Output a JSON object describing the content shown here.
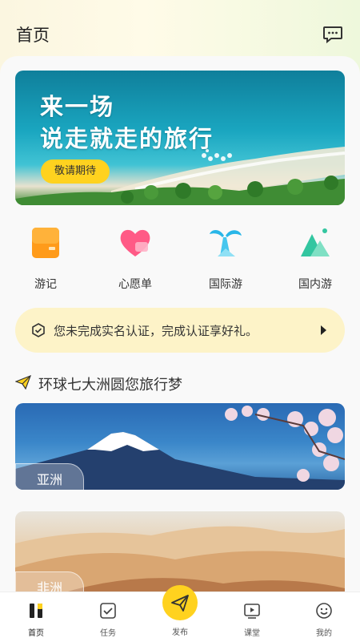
{
  "header": {
    "title": "首页",
    "message_icon": "message-icon"
  },
  "banner": {
    "line1": "来一场",
    "line2": "说走就走的旅行",
    "button": "敬请期待"
  },
  "categories": [
    {
      "label": "游记",
      "icon": "travel-notes-icon",
      "color": "#ff9b1a"
    },
    {
      "label": "心愿单",
      "icon": "heart-icon",
      "color": "#ff5a86"
    },
    {
      "label": "国际游",
      "icon": "palm-tree-icon",
      "color": "#29b6e8"
    },
    {
      "label": "国内游",
      "icon": "mountain-icon",
      "color": "#33c6a0"
    }
  ],
  "notice": {
    "text": "您未完成实名认证，完成认证享好礼。"
  },
  "section": {
    "title": "环球七大洲圆您旅行梦"
  },
  "continents": [
    {
      "label": "亚洲"
    },
    {
      "label": "非洲"
    }
  ],
  "tabs": [
    {
      "label": "首页",
      "icon": "home-icon"
    },
    {
      "label": "任务",
      "icon": "task-icon"
    },
    {
      "label": "发布",
      "icon": "paper-plane-icon"
    },
    {
      "label": "课堂",
      "icon": "video-class-icon"
    },
    {
      "label": "我的",
      "icon": "smile-icon"
    }
  ],
  "colors": {
    "accent": "#ffd21f",
    "notice_bg": "#fdf3c8"
  }
}
